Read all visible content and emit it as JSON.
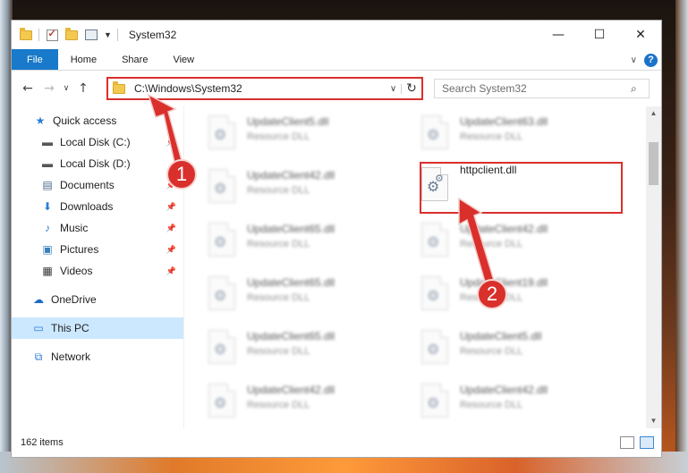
{
  "window": {
    "title": "System32",
    "controls": {
      "minimize": "—",
      "maximize": "☐",
      "close": "✕"
    }
  },
  "ribbon": {
    "tabs": [
      "File",
      "Home",
      "Share",
      "View"
    ],
    "help": "?"
  },
  "address": {
    "path": "C:\\Windows\\System32"
  },
  "search": {
    "placeholder": "Search System32"
  },
  "sidebar": {
    "quick_access": "Quick access",
    "items": [
      {
        "label": "Local Disk (C:)",
        "icon": "drive-icon",
        "pinned": true
      },
      {
        "label": "Local Disk (D:)",
        "icon": "drive-icon",
        "pinned": false
      },
      {
        "label": "Documents",
        "icon": "documents-icon",
        "pinned": true
      },
      {
        "label": "Downloads",
        "icon": "downloads-icon",
        "pinned": true
      },
      {
        "label": "Music",
        "icon": "music-icon",
        "pinned": true
      },
      {
        "label": "Pictures",
        "icon": "pictures-icon",
        "pinned": true
      },
      {
        "label": "Videos",
        "icon": "videos-icon",
        "pinned": true
      }
    ],
    "onedrive": "OneDrive",
    "this_pc": "This PC",
    "network": "Network"
  },
  "files": {
    "left_column": [
      {
        "name": "UpdateClient5.dll",
        "type": "Resource DLL"
      },
      {
        "name": "UpdateClient42.dll",
        "type": "Resource DLL"
      },
      {
        "name": "UpdateClient65.dll",
        "type": "Resource DLL"
      },
      {
        "name": "UpdateClient65.dll",
        "type": "Resource DLL"
      },
      {
        "name": "UpdateClient65.dll",
        "type": "Resource DLL"
      },
      {
        "name": "UpdateClient42.dll",
        "type": "Resource DLL"
      }
    ],
    "right_column": [
      {
        "name": "UpdateClient63.dll",
        "type": "Resource DLL"
      },
      {
        "name": "httpclient.dll",
        "type": ""
      },
      {
        "name": "UpdateClient42.dll",
        "type": "Resource DLL"
      },
      {
        "name": "UpdateClient19.dll",
        "type": "Resource DLL"
      },
      {
        "name": "UpdateClient5.dll",
        "type": "Resource DLL"
      },
      {
        "name": "UpdateClient42.dll",
        "type": "Resource DLL"
      }
    ],
    "highlighted": "httpclient.dll"
  },
  "status": {
    "item_count": "162 items"
  },
  "annotations": {
    "step1": "1",
    "step2": "2",
    "color": "#d9302c"
  }
}
